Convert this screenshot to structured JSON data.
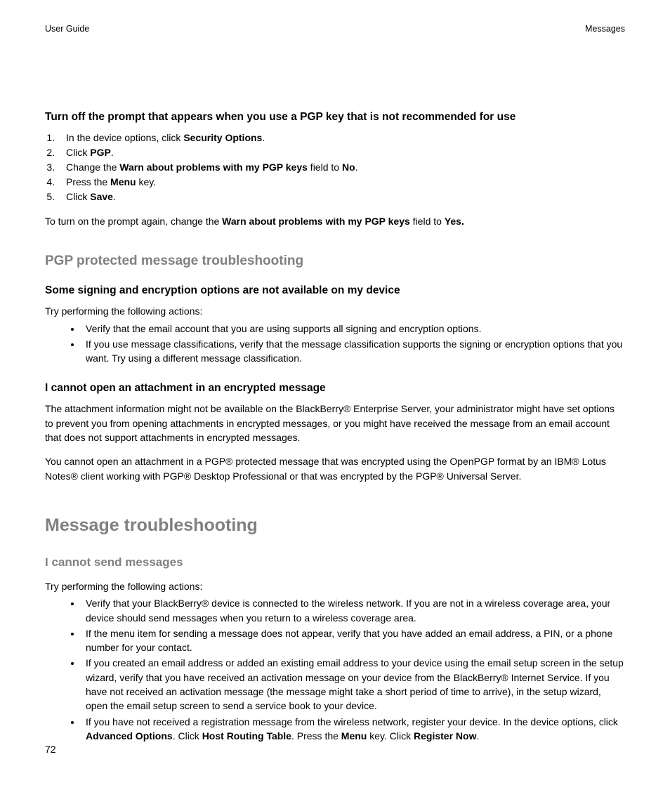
{
  "header": {
    "left": "User Guide",
    "right": "Messages"
  },
  "pageNumber": "72",
  "s1": {
    "title": "Turn off the prompt that appears when you use a PGP key that is not recommended for use",
    "steps": {
      "i1": {
        "pre": "In the device options, click ",
        "b": "Security Options",
        "post": "."
      },
      "i2": {
        "pre": "Click ",
        "b": "PGP",
        "post": "."
      },
      "i3": {
        "pre": "Change the ",
        "b1": "Warn about problems with my PGP keys",
        "mid": " field to ",
        "b2": "No",
        "post": "."
      },
      "i4": {
        "pre": "Press the ",
        "b": "Menu",
        "post": " key."
      },
      "i5": {
        "pre": "Click ",
        "b": "Save",
        "post": "."
      }
    },
    "note": {
      "pre": "To turn on the prompt again, change the ",
      "b1": "Warn about problems with my PGP keys",
      "mid": " field to ",
      "b2": "Yes.",
      "post": ""
    }
  },
  "s2": {
    "title": "PGP protected message troubleshooting",
    "sub1": {
      "title": "Some signing and encryption options are not available on my device",
      "intro": "Try performing the following actions:",
      "b1": "Verify that the email account that you are using supports all signing and encryption options.",
      "b2": "If you use message classifications, verify that the message classification supports the signing or encryption options that you want. Try using a different message classification."
    },
    "sub2": {
      "title": "I cannot open an attachment in an encrypted message",
      "p1": "The attachment information might not be available on the BlackBerry® Enterprise Server, your administrator might have set options to prevent you from opening attachments in encrypted messages, or you might have received the message from an email account that does not support attachments in encrypted messages.",
      "p2": "You cannot open an attachment in a PGP® protected message that was encrypted using the OpenPGP format by an IBM® Lotus Notes® client working with PGP® Desktop Professional or that was encrypted by the PGP® Universal Server."
    }
  },
  "s3": {
    "title": "Message troubleshooting",
    "sub1": {
      "title": "I cannot send messages",
      "intro": "Try performing the following actions:",
      "b1": "Verify that your BlackBerry® device is connected to the wireless network. If you are not in a wireless coverage area, your device should send messages when you return to a wireless coverage area.",
      "b2": "If the menu item for sending a message does not appear, verify that you have added an email address, a PIN, or a phone number for your contact.",
      "b3": "If you created an email address or added an existing email address to your device using the email setup screen in the setup wizard, verify that you have received an activation message on your device from the BlackBerry® Internet Service. If you have not received an activation message (the message might take a short period of time to arrive), in the setup wizard, open the email setup screen to send a service book to your device.",
      "b4": {
        "pre": "If you have not received a registration message from the wireless network, register your device. In the device options, click ",
        "b1": "Advanced Options",
        "t1": ". Click ",
        "b2": "Host Routing Table",
        "t2": ". Press the ",
        "b3": "Menu",
        "t3": " key. Click ",
        "b4": "Register Now",
        "t4": "."
      }
    }
  }
}
